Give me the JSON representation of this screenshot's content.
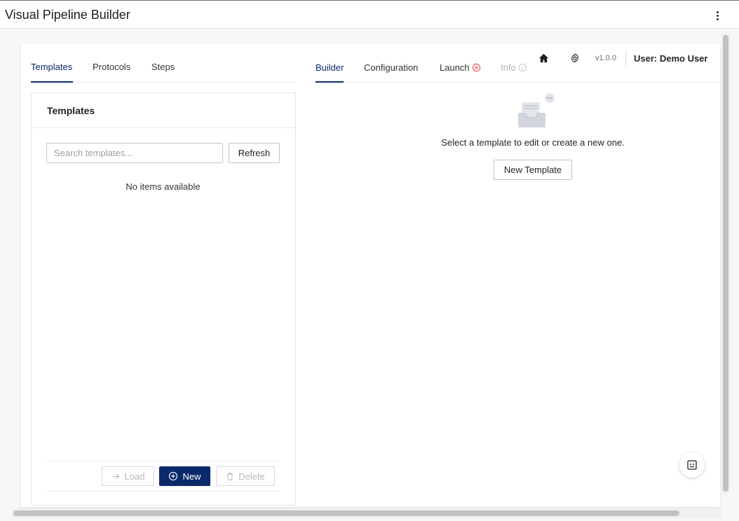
{
  "app": {
    "title": "Visual Pipeline Builder"
  },
  "left_tabs": [
    {
      "label": "Templates",
      "active": true
    },
    {
      "label": "Protocols",
      "active": false
    },
    {
      "label": "Steps",
      "active": false
    }
  ],
  "templates_panel": {
    "title": "Templates",
    "search_placeholder": "Search templates...",
    "search_value": "",
    "refresh_label": "Refresh",
    "empty_text": "No items available",
    "actions": {
      "load_label": "Load",
      "new_label": "New",
      "delete_label": "Delete"
    }
  },
  "right_tabs": [
    {
      "label": "Builder",
      "active": true
    },
    {
      "label": "Configuration",
      "active": false
    },
    {
      "label": "Launch",
      "active": false,
      "icon": "error-circle-icon"
    },
    {
      "label": "Info",
      "active": false,
      "disabled": true,
      "icon": "info-circle-icon"
    }
  ],
  "toolbar": {
    "home_icon": "home-icon",
    "settings_icon": "gear-icon",
    "version": "v1.0.0",
    "user": "User: Demo User"
  },
  "builder": {
    "empty_message": "Select a template to edit or create a new one.",
    "new_template_label": "New Template"
  },
  "colors": {
    "accent": "#0b2a6b",
    "error": "#e5484d",
    "border": "#e5e7eb"
  }
}
